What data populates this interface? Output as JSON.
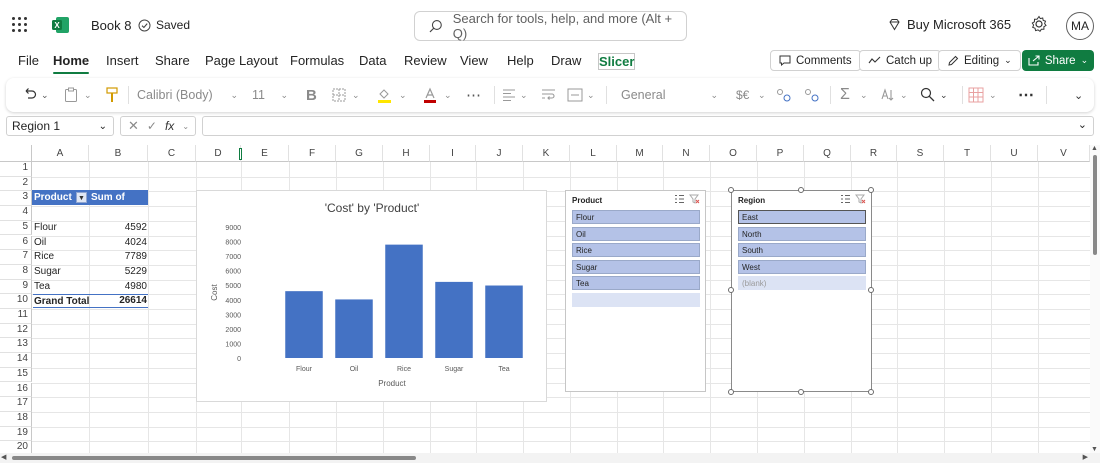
{
  "title_bar": {
    "book_name": "Book 8",
    "saved_label": "Saved",
    "search_placeholder": "Search for tools, help, and more (Alt + Q)",
    "buy_label": "Buy Microsoft 365",
    "avatar_initials": "MA"
  },
  "tabs": [
    {
      "label": "File"
    },
    {
      "label": "Home"
    },
    {
      "label": "Insert"
    },
    {
      "label": "Share"
    },
    {
      "label": "Page Layout"
    },
    {
      "label": "Formulas"
    },
    {
      "label": "Data"
    },
    {
      "label": "Review"
    },
    {
      "label": "View"
    },
    {
      "label": "Help"
    },
    {
      "label": "Draw"
    },
    {
      "label": "Slicer"
    }
  ],
  "actions": {
    "comments_label": "Comments",
    "catchup_label": "Catch up",
    "editing_label": "Editing",
    "share_label": "Share"
  },
  "ribbon": {
    "font_name": "Calibri (Body)",
    "font_size": "11",
    "number_format": "General"
  },
  "formula_bar": {
    "name_box": "Region 1",
    "fx_label": "fx",
    "formula": ""
  },
  "columns": [
    "A",
    "B",
    "C",
    "D",
    "E",
    "F",
    "G",
    "H",
    "I",
    "J",
    "K",
    "L",
    "M",
    "N",
    "O",
    "P",
    "Q",
    "R",
    "S",
    "T",
    "U",
    "V"
  ],
  "rows": [
    "1",
    "2",
    "3",
    "4",
    "5",
    "6",
    "7",
    "8",
    "9",
    "10",
    "11",
    "12",
    "13",
    "14",
    "15",
    "16",
    "17",
    "18",
    "19",
    "20"
  ],
  "pivot": {
    "header_product": "Product",
    "header_sum": "Sum of Cost",
    "rows": [
      {
        "product": "Flour",
        "cost": "4592"
      },
      {
        "product": "Oil",
        "cost": "4024"
      },
      {
        "product": "Rice",
        "cost": "7789"
      },
      {
        "product": "Sugar",
        "cost": "5229"
      },
      {
        "product": "Tea",
        "cost": "4980"
      }
    ],
    "grand_total_label": "Grand Total",
    "grand_total_value": "26614"
  },
  "chart_data": {
    "type": "bar",
    "title": "'Cost' by 'Product'",
    "xlabel": "Product",
    "ylabel": "Cost",
    "categories": [
      "Flour",
      "Oil",
      "Rice",
      "Sugar",
      "Tea"
    ],
    "values": [
      4592,
      4024,
      7789,
      5229,
      4980
    ],
    "ylim": [
      0,
      9000
    ],
    "yticks": [
      "0",
      "1000",
      "2000",
      "3000",
      "4000",
      "5000",
      "6000",
      "7000",
      "8000",
      "9000"
    ],
    "color": "#4472c4"
  },
  "slicer_product": {
    "title": "Product",
    "items": [
      "Flour",
      "Oil",
      "Rice",
      "Sugar",
      "Tea"
    ]
  },
  "slicer_region": {
    "title": "Region",
    "items": [
      "East",
      "North",
      "South",
      "West"
    ],
    "blank_label": "(blank)"
  },
  "colors": {
    "accent": "#107c41",
    "pivot_header": "#4472c4",
    "slicer_item": "#b4c2e7"
  }
}
